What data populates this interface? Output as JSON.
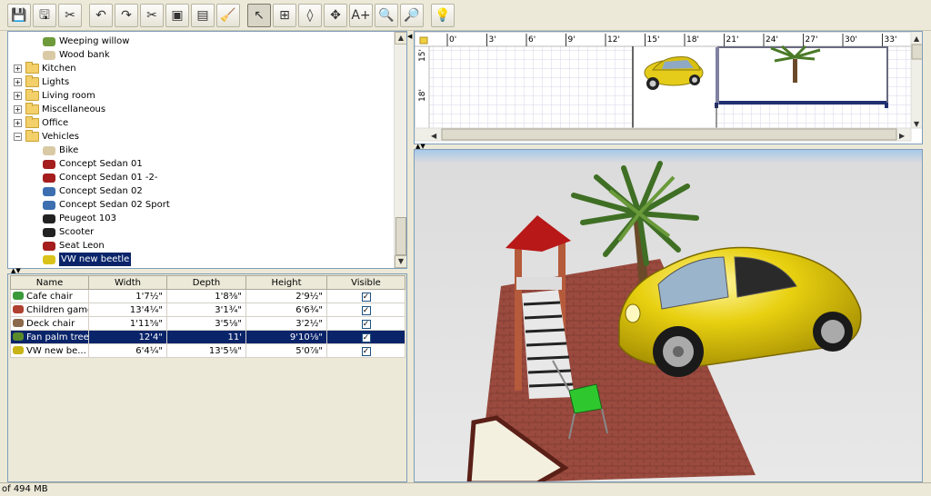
{
  "toolbar": {
    "buttons": [
      {
        "icon": "save-icon",
        "glyph": "💾"
      },
      {
        "icon": "export-icon",
        "glyph": "🖫"
      },
      {
        "icon": "preferences-icon",
        "glyph": "✂"
      },
      {
        "icon": "undo-icon",
        "glyph": "↶"
      },
      {
        "icon": "redo-icon",
        "glyph": "↷"
      },
      {
        "icon": "cut-icon",
        "glyph": "✂"
      },
      {
        "icon": "copy-icon",
        "glyph": "▣"
      },
      {
        "icon": "paste-icon",
        "glyph": "▤"
      },
      {
        "icon": "delete-icon",
        "glyph": "🧹"
      },
      {
        "icon": "select-mode-icon",
        "glyph": "↖"
      },
      {
        "icon": "create-walls-icon",
        "glyph": "⊞"
      },
      {
        "icon": "create-rooms-icon",
        "glyph": "◊"
      },
      {
        "icon": "create-dimensions-icon",
        "glyph": "✥"
      },
      {
        "icon": "add-text-icon",
        "glyph": "A+"
      },
      {
        "icon": "zoom-out-icon",
        "glyph": "🔍"
      },
      {
        "icon": "zoom-in-icon",
        "glyph": "🔎"
      },
      {
        "icon": "light-bulb-icon",
        "glyph": "💡"
      }
    ]
  },
  "catalog": {
    "items": [
      {
        "label": "Weeping willow",
        "type": "leaf",
        "icon": "tree-icon",
        "color": "green"
      },
      {
        "label": "Wood bank",
        "type": "leaf",
        "icon": "bench-icon",
        "color": "tan"
      },
      {
        "label": "Kitchen",
        "type": "folder"
      },
      {
        "label": "Lights",
        "type": "folder"
      },
      {
        "label": "Living room",
        "type": "folder"
      },
      {
        "label": "Miscellaneous",
        "type": "folder"
      },
      {
        "label": "Office",
        "type": "folder"
      },
      {
        "label": "Vehicles",
        "type": "folder",
        "expanded": true
      },
      {
        "label": "Bike",
        "type": "leaf",
        "icon": "bike-icon",
        "color": "tan"
      },
      {
        "label": "Concept Sedan 01",
        "type": "leaf",
        "icon": "car-icon",
        "color": "red"
      },
      {
        "label": "Concept Sedan 01 -2-",
        "type": "leaf",
        "icon": "car-icon",
        "color": "red"
      },
      {
        "label": "Concept Sedan 02",
        "type": "leaf",
        "icon": "car-icon",
        "color": "blue"
      },
      {
        "label": "Concept Sedan 02 Sport",
        "type": "leaf",
        "icon": "car-icon",
        "color": "blue"
      },
      {
        "label": "Peugeot 103",
        "type": "leaf",
        "icon": "moped-icon",
        "color": "black"
      },
      {
        "label": "Scooter",
        "type": "leaf",
        "icon": "scooter-icon",
        "color": "black"
      },
      {
        "label": "Seat Leon",
        "type": "leaf",
        "icon": "car-icon",
        "color": "red"
      },
      {
        "label": "VW new beetle",
        "type": "leaf",
        "icon": "car-icon",
        "color": "yellow",
        "selected": true
      }
    ]
  },
  "furniture_table": {
    "headers": [
      "Name",
      "Width",
      "Depth",
      "Height",
      "Visible"
    ],
    "rows": [
      {
        "name": "Cafe chair",
        "width": "1'7½\"",
        "depth": "1'8⅜\"",
        "height": "2'9½\"",
        "visible": true,
        "icon_color": "#3a9a3a"
      },
      {
        "name": "Children game",
        "width": "13'4¼\"",
        "depth": "3'1¾\"",
        "height": "6'6¾\"",
        "visible": true,
        "icon_color": "#b04030"
      },
      {
        "name": "Deck chair",
        "width": "1'11⅝\"",
        "depth": "3'5⅛\"",
        "height": "3'2½\"",
        "visible": true,
        "icon_color": "#8a6a4a"
      },
      {
        "name": "Fan palm tree",
        "width": "12'4\"",
        "depth": "11'",
        "height": "9'10⅛\"",
        "visible": true,
        "icon_color": "#5a8a2a",
        "selected": true
      },
      {
        "name": "VW new be...",
        "width": "6'4¼\"",
        "depth": "13'5⅛\"",
        "height": "5'0⅞\"",
        "visible": true,
        "icon_color": "#c8b416"
      }
    ]
  },
  "plan": {
    "ruler_top": [
      "0'",
      "3'",
      "6'",
      "9'",
      "12'",
      "15'",
      "18'",
      "21'",
      "24'",
      "27'",
      "30'",
      "33'"
    ],
    "ruler_left": [
      "15'",
      "18'"
    ]
  },
  "status": {
    "text": "of 494 MB"
  }
}
